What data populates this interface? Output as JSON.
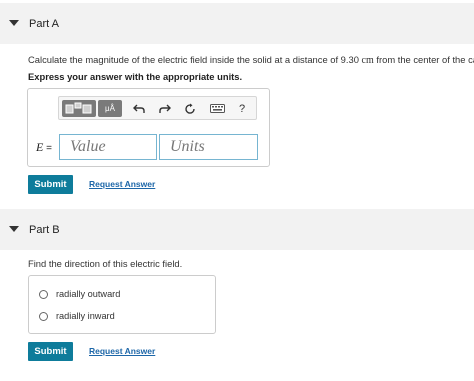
{
  "partA": {
    "title": "Part A",
    "question_text": "Calculate the magnitude of the electric field inside the solid at a distance of 9.30",
    "question_unit": "cm",
    "question_text_end": "from the center of the cavity.",
    "instruction": "Express your answer with the appropriate units.",
    "toolbar": {
      "templates_icon": "templates-icon",
      "units_icon": "units-icon",
      "units_icon_label": "μÅ",
      "undo_icon": "undo-icon",
      "redo_icon": "redo-icon",
      "reset_icon": "reset-icon",
      "keyboard_icon": "keyboard-icon",
      "help_label": "?"
    },
    "equation_label": "E",
    "equals": "=",
    "value_placeholder": "Value",
    "units_placeholder": "Units",
    "submit_label": "Submit",
    "request_answer_label": "Request Answer"
  },
  "partB": {
    "title": "Part B",
    "question_text": "Find the direction of this electric field.",
    "options": [
      "radially outward",
      "radially inward"
    ],
    "submit_label": "Submit",
    "request_answer_label": "Request Answer"
  },
  "colors": {
    "submit_bg": "#0e7c9b",
    "link": "#1c66a8",
    "header_bg": "#f2f2f2",
    "input_border": "#76b5d1"
  }
}
